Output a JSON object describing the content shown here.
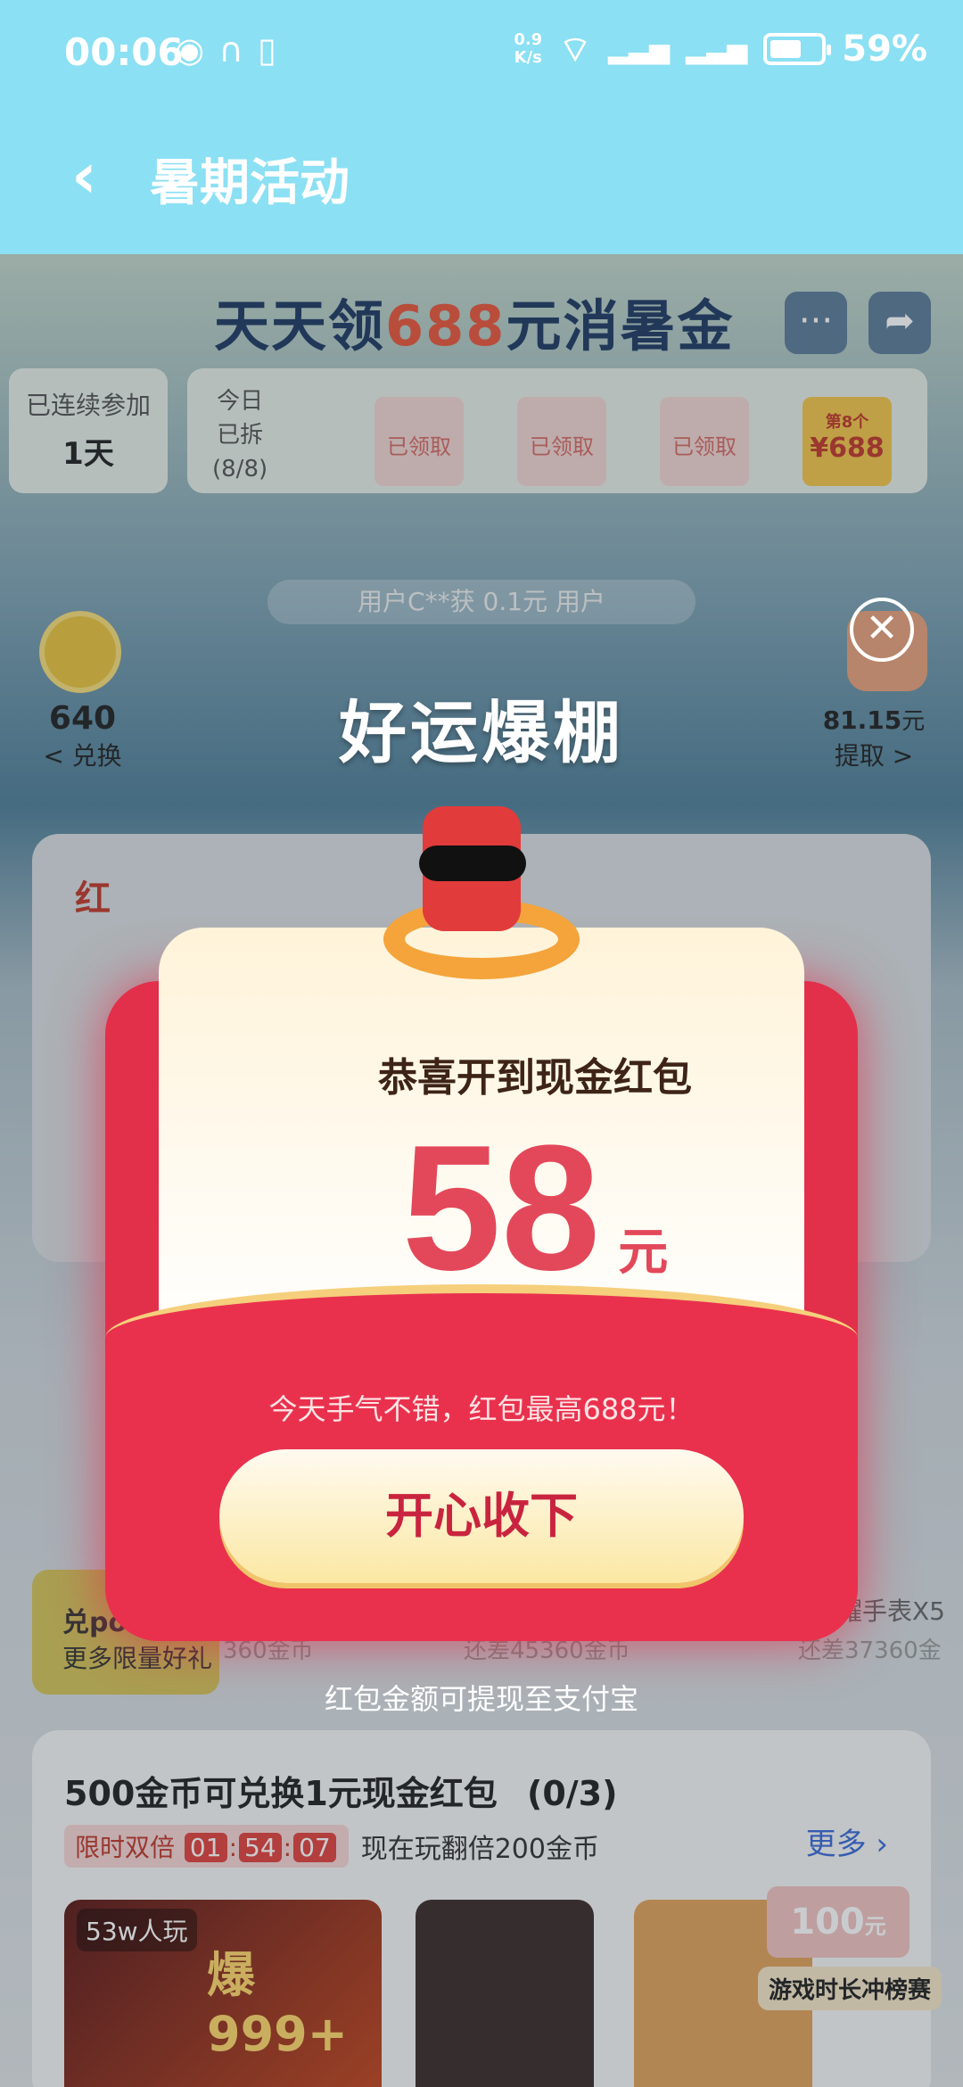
{
  "status": {
    "time": "00:06",
    "net_speed_value": "0.9",
    "net_speed_unit": "K/s",
    "battery": "59%"
  },
  "header": {
    "back_icon": "chevron-left-icon",
    "title": "暑期活动"
  },
  "banner": {
    "prefix": "天天领",
    "number": "688",
    "suffix": "元消暑金"
  },
  "progress": {
    "streak_label": "已连续参加",
    "streak_value": "1天",
    "today_line1": "今日",
    "today_line2": "已拆",
    "today_count": "(8/8)",
    "claimed_label": "已领取",
    "final_label": "第8个",
    "final_amount": "¥688"
  },
  "ticker": {
    "text": "用户C**获      0.1元    用户"
  },
  "wallet": {
    "coins": "640",
    "coins_link": "< 兑换",
    "cash_value": "81.15",
    "cash_unit": "元",
    "cash_link": "提取 >"
  },
  "redpacket_card": {
    "title": "红"
  },
  "exchange": {
    "pocket_title": "兑pock",
    "pocket_sub": "更多限量好礼",
    "item1": "360金币",
    "item2": "还差45360金币",
    "item3": "还差37360金",
    "watch_title": "耀手表X5"
  },
  "games": {
    "title": "500金币可兑换1元现金红包",
    "progress": "(0/3)",
    "timer_label": "限时双倍",
    "timer_h": "01",
    "timer_m": "54",
    "timer_s": "07",
    "timer_sep": ":",
    "promo": "现在玩翻倍200金币",
    "more": "更多",
    "game1_badge": "53w人玩",
    "game1_big": "爆999+",
    "coupon_amount": "100",
    "coupon_unit": "元",
    "rank_label": "游戏时长冲榜赛"
  },
  "modal": {
    "headline": "好运爆棚",
    "congrats": "恭喜开到现金红包",
    "amount": "58",
    "unit": "元",
    "tip": "今天手气不错，红包最高688元！",
    "accept_label": "开心收下",
    "withdraw_tip": "红包金额可提现至支付宝",
    "close_icon": "close-icon"
  }
}
